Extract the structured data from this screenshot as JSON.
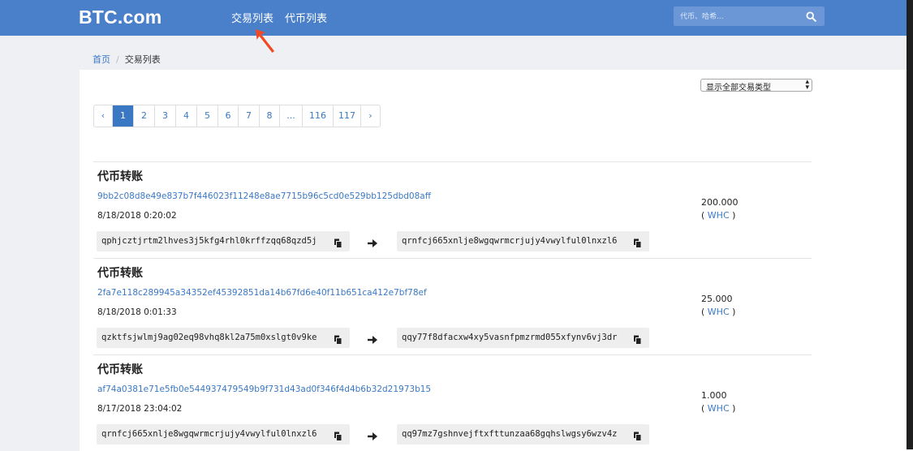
{
  "header": {
    "logo": "BTC.com",
    "nav": [
      {
        "label": "交易列表"
      },
      {
        "label": "代币列表"
      }
    ],
    "search": {
      "placeholder": "代币、哈希..."
    }
  },
  "breadcrumb": {
    "home": "首页",
    "current": "交易列表"
  },
  "filter": {
    "selected": "显示全部交易类型"
  },
  "pagination": {
    "prev": "‹",
    "pages": [
      "1",
      "2",
      "3",
      "4",
      "5",
      "6",
      "7",
      "8",
      "...",
      "116",
      "117"
    ],
    "next": "›",
    "active": "1"
  },
  "transactions": [
    {
      "title": "代币转账",
      "hash": "9bb2c08d8e49e837b7f446023f11248e8ae7715b96c5cd0e529bb125dbd08aff",
      "time": "8/18/2018 0:20:02",
      "from": "qphjcztjrtm2lhves3j5kfg4rhl0krffzqq68qzd5j",
      "to": "qrnfcj665xnlje8wgqwrmcrjujy4vwylful0lnxzl6",
      "amount": "200.000",
      "unit_open": "(",
      "unit": "WHC",
      "unit_close": ")"
    },
    {
      "title": "代币转账",
      "hash": "2fa7e118c289945a34352ef45392851da14b67fd6e40f11b651ca412e7bf78ef",
      "time": "8/18/2018 0:01:33",
      "from": "qzktfsjwlmj9ag02eq98vhq8kl2a75m0xslgt0v9ke",
      "to": "qqy77f8dfacxw4xy5vasnfpmzrmd055xfynv6vj3dr",
      "amount": "25.000",
      "unit_open": "(",
      "unit": "WHC",
      "unit_close": ")"
    },
    {
      "title": "代币转账",
      "hash": "af74a0381e71e5fb0e544937479549b9f731d43ad0f346f4d4b6b32d21973b15",
      "time": "8/17/2018 23:04:02",
      "from": "qrnfcj665xnlje8wgqwrmcrjujy4vwylful0lnxzl6",
      "to": "qq97mz7gshnvejftxfttunzaa68gqhslwgsy6wzv4z",
      "amount": "1.000",
      "unit_open": "(",
      "unit": "WHC",
      "unit_close": ")"
    }
  ],
  "colors": {
    "header_bg": "#4a7fc9",
    "link": "#3a78c3",
    "annotation_arrow": "#ef4a23"
  }
}
